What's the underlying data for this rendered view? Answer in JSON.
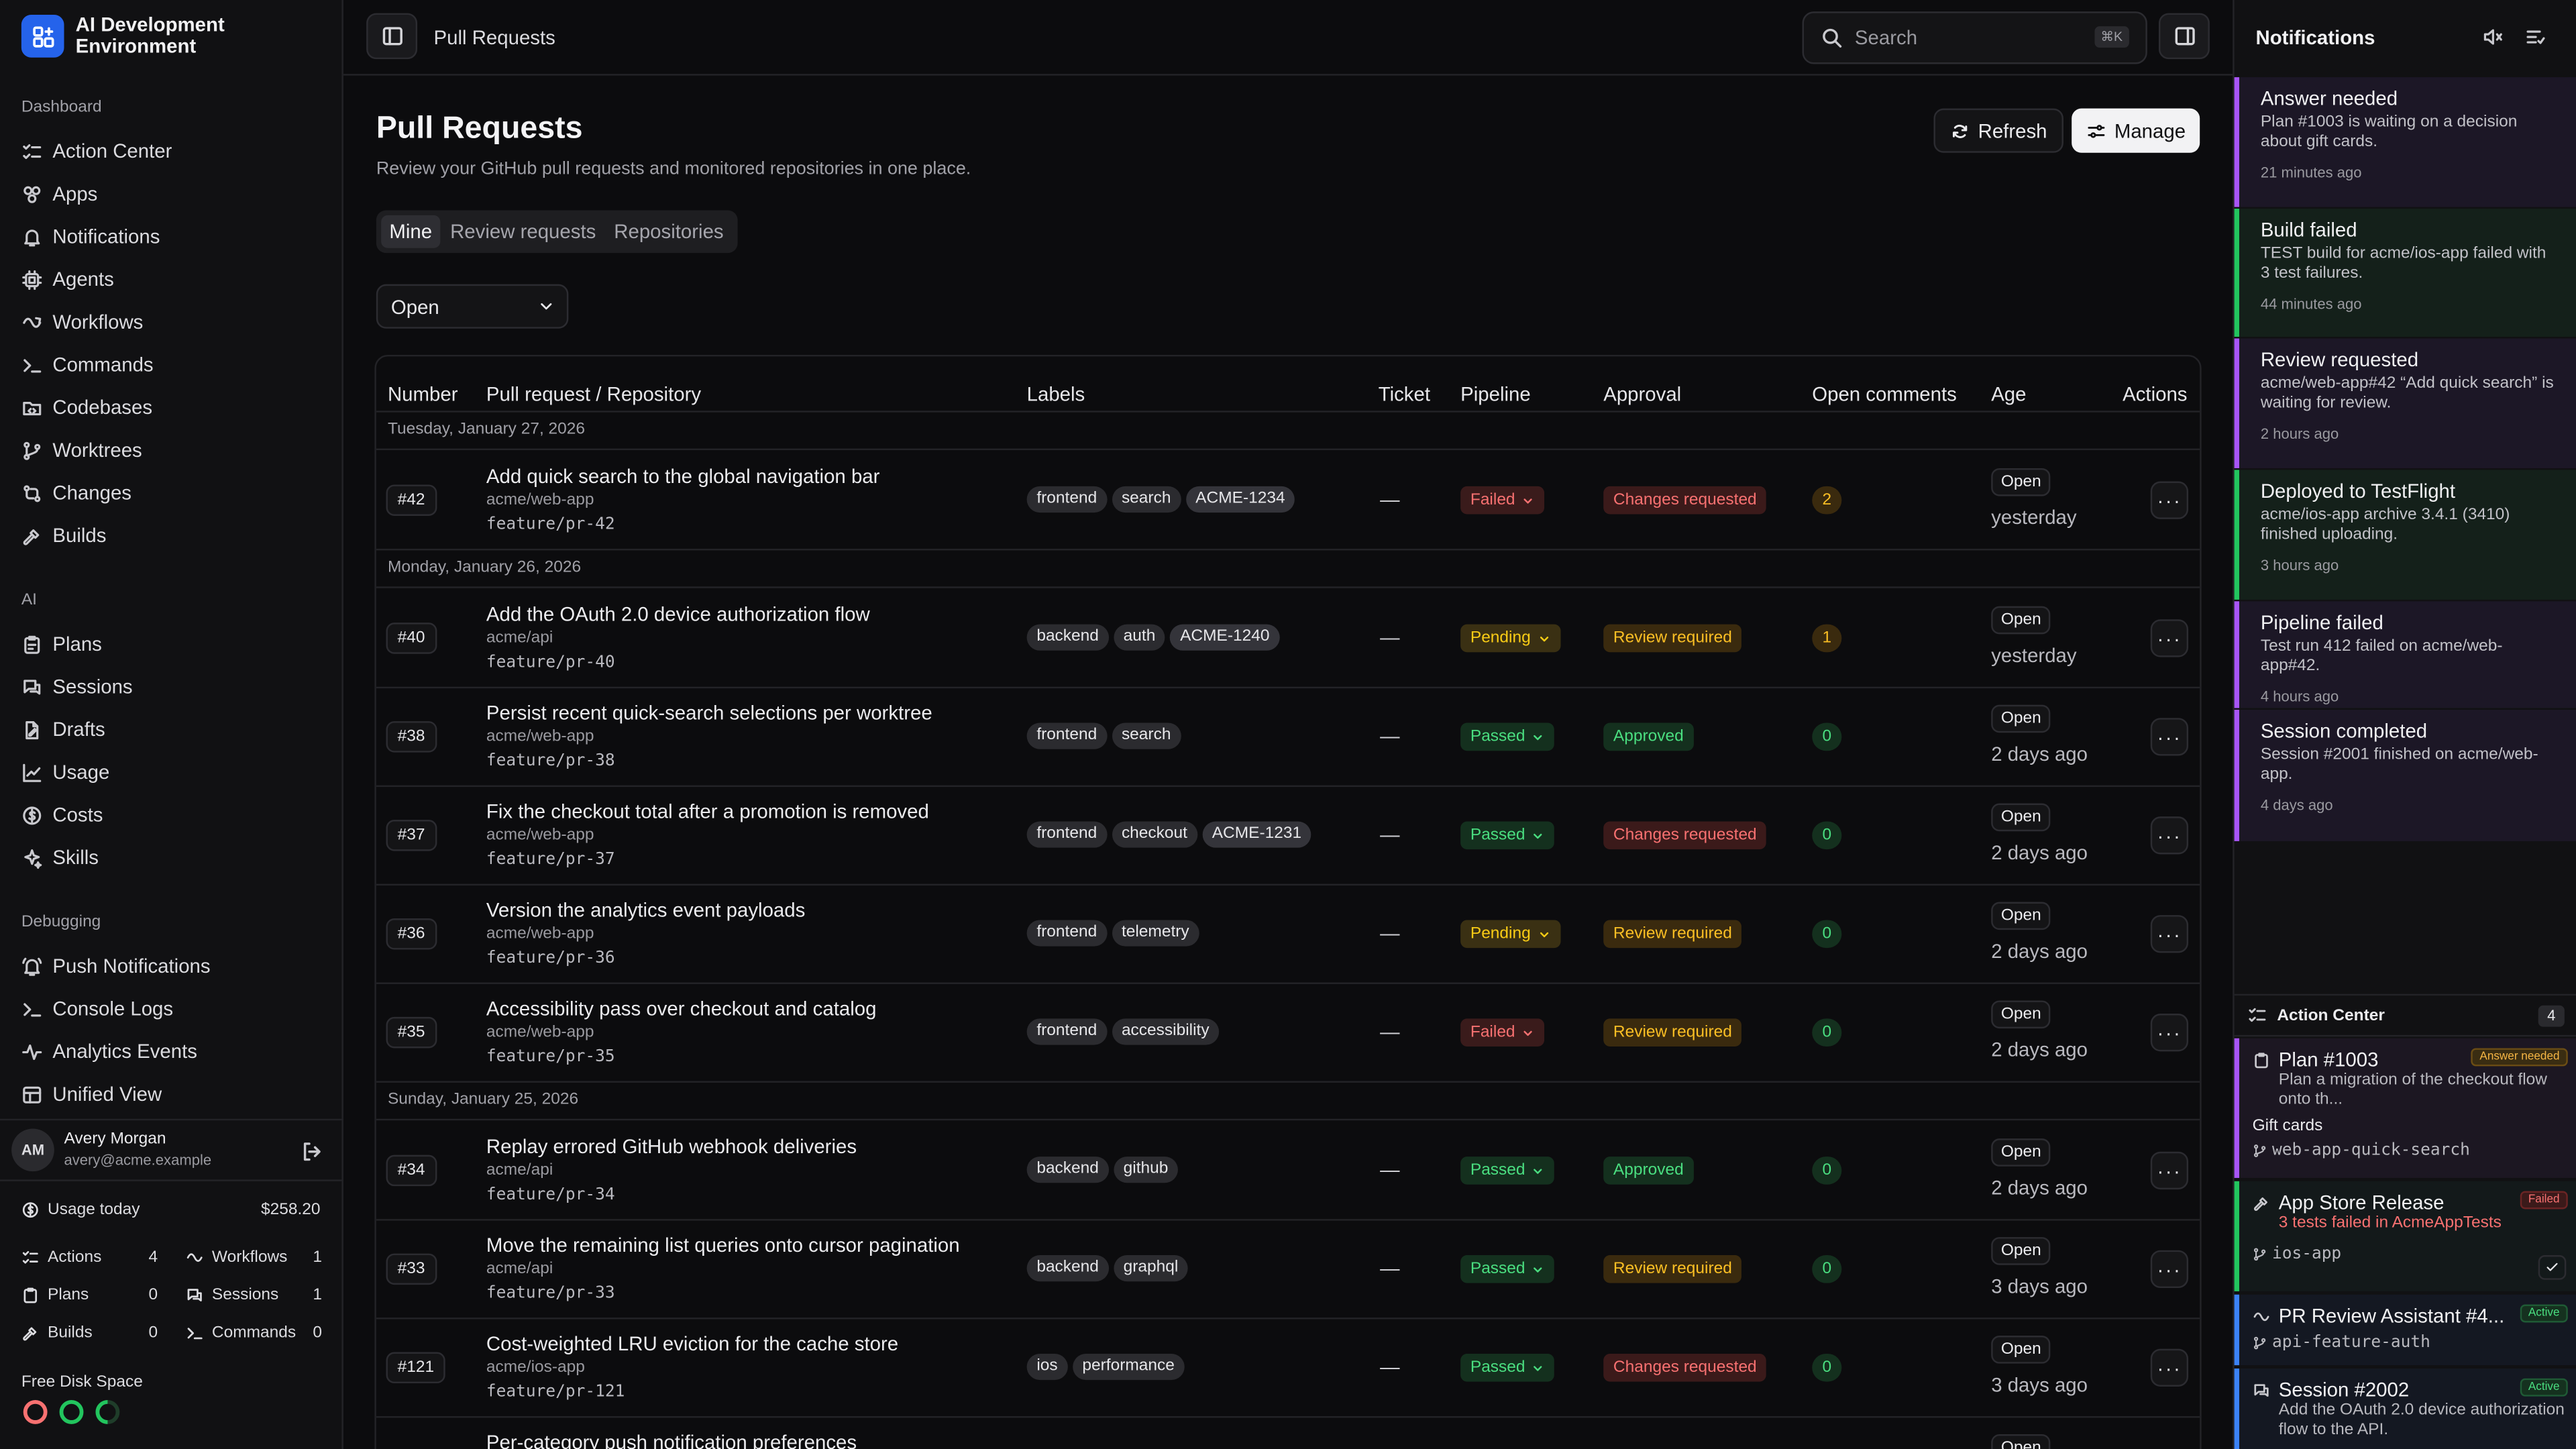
{
  "app": {
    "name_line1": "AI Development",
    "name_line2": "Environment"
  },
  "sidebar": {
    "sections": [
      {
        "label": "Dashboard",
        "items": [
          "Action Center",
          "Apps",
          "Notifications",
          "Agents",
          "Workflows",
          "Commands",
          "Codebases",
          "Worktrees",
          "Changes",
          "Builds"
        ]
      },
      {
        "label": "AI",
        "items": [
          "Plans",
          "Sessions",
          "Drafts",
          "Usage",
          "Costs",
          "Skills"
        ]
      },
      {
        "label": "Debugging",
        "items": [
          "Push Notifications",
          "Console Logs",
          "Analytics Events",
          "Unified View"
        ]
      }
    ],
    "user": {
      "initials": "AM",
      "name": "Avery Morgan",
      "email": "avery@acme.example"
    },
    "usage": {
      "label": "Usage today",
      "value": "$258.20"
    },
    "stats": [
      {
        "label": "Actions",
        "value": "4"
      },
      {
        "label": "Workflows",
        "value": "1"
      },
      {
        "label": "Plans",
        "value": "0"
      },
      {
        "label": "Sessions",
        "value": "1"
      },
      {
        "label": "Builds",
        "value": "0"
      },
      {
        "label": "Commands",
        "value": "0"
      }
    ],
    "disk_label": "Free Disk Space"
  },
  "topbar": {
    "breadcrumb": "Pull Requests",
    "search_placeholder": "Search",
    "search_shortcut": "⌘K"
  },
  "page": {
    "title": "Pull Requests",
    "subtitle": "Review your GitHub pull requests and monitored repositories in one place.",
    "refresh_label": "Refresh",
    "manage_label": "Manage",
    "tabs": [
      "Mine",
      "Review requests",
      "Repositories"
    ],
    "filter_value": "Open"
  },
  "table": {
    "headers": [
      "Number",
      "Pull request / Repository",
      "Labels",
      "Ticket",
      "Pipeline",
      "Approval",
      "Open comments",
      "Age",
      "Actions"
    ],
    "groups": [
      {
        "date": "Tuesday, January 27, 2026",
        "rows": [
          {
            "num": "#42",
            "title": "Add quick search to the global navigation bar",
            "repo": "acme/web-app",
            "branch": "feature/pr-42",
            "labels": [
              "frontend",
              "search"
            ],
            "ticket_label": "ACME-1234",
            "ticket": "—",
            "pipeline": "Failed",
            "approval": "Changes requested",
            "comments": "2",
            "status": "Open",
            "age": "yesterday"
          }
        ]
      },
      {
        "date": "Monday, January 26, 2026",
        "rows": [
          {
            "num": "#40",
            "title": "Add the OAuth 2.0 device authorization flow",
            "repo": "acme/api",
            "branch": "feature/pr-40",
            "labels": [
              "backend",
              "auth"
            ],
            "ticket_label": "ACME-1240",
            "ticket": "—",
            "pipeline": "Pending",
            "approval": "Review required",
            "comments": "1",
            "status": "Open",
            "age": "yesterday"
          },
          {
            "num": "#38",
            "title": "Persist recent quick-search selections per worktree",
            "repo": "acme/web-app",
            "branch": "feature/pr-38",
            "labels": [
              "frontend",
              "search"
            ],
            "ticket_label": "",
            "ticket": "—",
            "pipeline": "Passed",
            "approval": "Approved",
            "comments": "0",
            "status": "Open",
            "age": "2 days ago"
          },
          {
            "num": "#37",
            "title": "Fix the checkout total after a promotion is removed",
            "repo": "acme/web-app",
            "branch": "feature/pr-37",
            "labels": [
              "frontend",
              "checkout"
            ],
            "ticket_label": "ACME-1231",
            "ticket": "—",
            "pipeline": "Passed",
            "approval": "Changes requested",
            "comments": "0",
            "status": "Open",
            "age": "2 days ago"
          },
          {
            "num": "#36",
            "title": "Version the analytics event payloads",
            "repo": "acme/web-app",
            "branch": "feature/pr-36",
            "labels": [
              "frontend",
              "telemetry"
            ],
            "ticket_label": "",
            "ticket": "—",
            "pipeline": "Pending",
            "approval": "Review required",
            "comments": "0",
            "status": "Open",
            "age": "2 days ago"
          },
          {
            "num": "#35",
            "title": "Accessibility pass over checkout and catalog",
            "repo": "acme/web-app",
            "branch": "feature/pr-35",
            "labels": [
              "frontend",
              "accessibility"
            ],
            "ticket_label": "",
            "ticket": "—",
            "pipeline": "Failed",
            "approval": "Review required",
            "comments": "0",
            "status": "Open",
            "age": "2 days ago"
          }
        ]
      },
      {
        "date": "Sunday, January 25, 2026",
        "rows": [
          {
            "num": "#34",
            "title": "Replay errored GitHub webhook deliveries",
            "repo": "acme/api",
            "branch": "feature/pr-34",
            "labels": [
              "backend",
              "github"
            ],
            "ticket_label": "",
            "ticket": "—",
            "pipeline": "Passed",
            "approval": "Approved",
            "comments": "0",
            "status": "Open",
            "age": "2 days ago"
          },
          {
            "num": "#33",
            "title": "Move the remaining list queries onto cursor pagination",
            "repo": "acme/api",
            "branch": "feature/pr-33",
            "labels": [
              "backend",
              "graphql"
            ],
            "ticket_label": "",
            "ticket": "—",
            "pipeline": "Passed",
            "approval": "Review required",
            "comments": "0",
            "status": "Open",
            "age": "3 days ago"
          },
          {
            "num": "#121",
            "title": "Cost-weighted LRU eviction for the cache store",
            "repo": "acme/ios-app",
            "branch": "feature/pr-121",
            "labels": [
              "ios",
              "performance"
            ],
            "ticket_label": "",
            "ticket": "—",
            "pipeline": "Passed",
            "approval": "Changes requested",
            "comments": "0",
            "status": "Open",
            "age": "3 days ago"
          },
          {
            "num": "",
            "title": "Per-category push notification preferences",
            "repo": "",
            "branch": "",
            "labels": [],
            "ticket_label": "",
            "ticket": "",
            "pipeline": "",
            "approval": "",
            "comments": "",
            "status": "Open",
            "age": ""
          }
        ]
      }
    ]
  },
  "notifications": {
    "title": "Notifications",
    "items": [
      {
        "title": "Answer needed",
        "body": "Plan #1003 is waiting on a decision about gift cards.",
        "time": "21 minutes ago",
        "accent": "#a855f7"
      },
      {
        "title": "Build failed",
        "body": "TEST build for acme/ios-app failed with 3 test failures.",
        "time": "44 minutes ago",
        "accent": "#22c55e"
      },
      {
        "title": "Review requested",
        "body": "acme/web-app#42 “Add quick search” is waiting for review.",
        "time": "2 hours ago",
        "accent": "#a855f7"
      },
      {
        "title": "Deployed to TestFlight",
        "body": "acme/ios-app archive 3.4.1 (3410) finished uploading.",
        "time": "3 hours ago",
        "accent": "#22c55e"
      },
      {
        "title": "Pipeline failed",
        "body": "Test run 412 failed on acme/web-app#42.",
        "time": "4 hours ago",
        "accent": "#a855f7"
      },
      {
        "title": "Session completed",
        "body": "Session #2001 finished on acme/web-app.",
        "time": "4 days ago",
        "accent": "#a855f7"
      }
    ]
  },
  "action_center": {
    "title": "Action Center",
    "count": "4",
    "cards": [
      {
        "title": "Plan #1003",
        "badge": "Answer needed",
        "desc": "Plan a migration of the checkout flow onto th...",
        "extra": "Gift cards",
        "worktree": "web-app-quick-search",
        "accent": "#a855f7"
      },
      {
        "title": "App Store Release",
        "badge": "Failed",
        "desc": "3 tests failed in AcmeAppTests",
        "extra": "",
        "worktree": "ios-app",
        "accent": "#22c55e"
      },
      {
        "title": "PR Review Assistant #4...",
        "badge": "Active",
        "desc": "",
        "extra": "",
        "worktree": "api-feature-auth",
        "accent": "#3b82f6"
      },
      {
        "title": "Session #2002",
        "badge": "Active",
        "desc": "Add the OAuth 2.0 device authorization flow to the API.",
        "extra": "",
        "worktree": "",
        "accent": "#3b82f6"
      }
    ]
  },
  "colors": {
    "accent": "#2563eb",
    "failed": "#f87171",
    "pending": "#facc15",
    "passed": "#4ade80"
  }
}
